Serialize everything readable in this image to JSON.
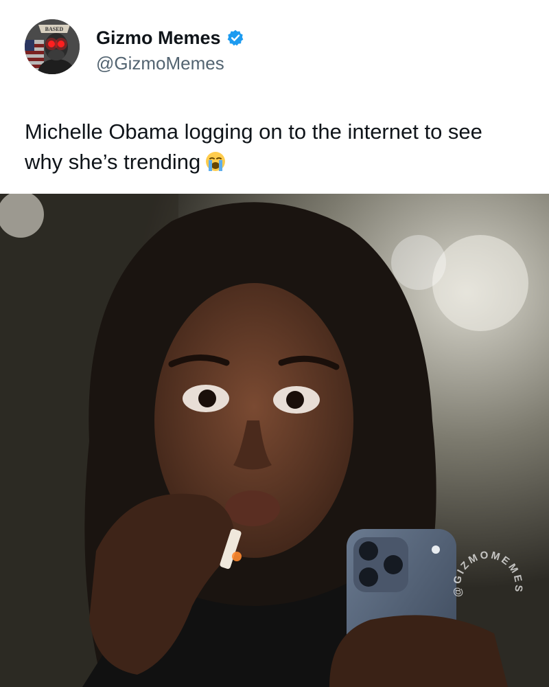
{
  "post": {
    "author": {
      "display_name": "Gizmo Memes",
      "handle": "@GizmoMemes",
      "verified": true,
      "avatar_badge_text": "BASED"
    },
    "caption": "Michelle Obama logging on to the internet to see why she’s trending",
    "caption_emoji": "loudly-crying-face-icon",
    "media": {
      "type": "photo",
      "watermark_text": "@GIZMOMEMES"
    }
  },
  "colors": {
    "verified_blue": "#1d9bf0",
    "text_primary": "#0f1419",
    "text_secondary": "#536471"
  }
}
